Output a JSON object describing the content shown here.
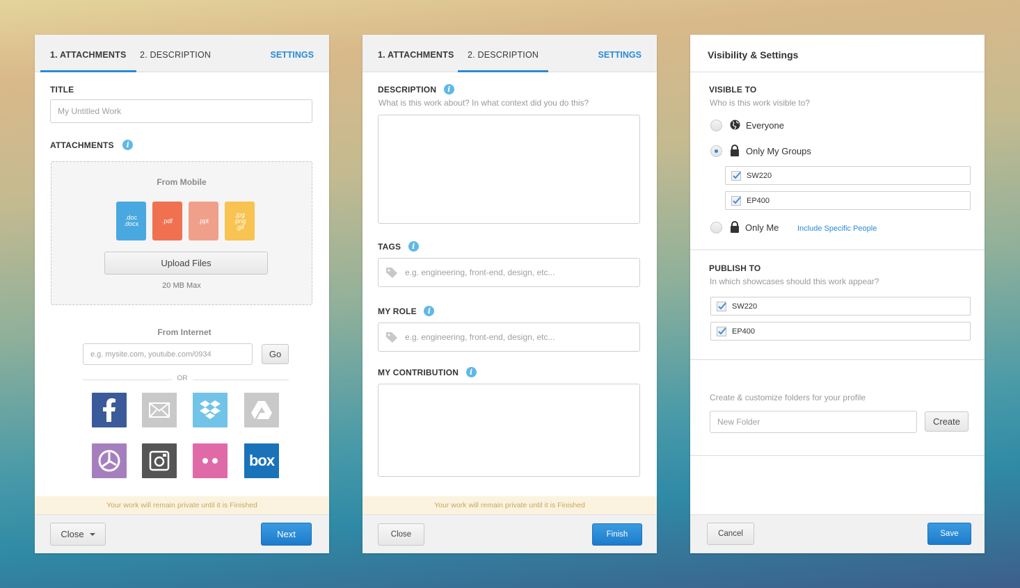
{
  "panel1": {
    "tabs": [
      "1. ATTACHMENTS",
      "2. DESCRIPTION"
    ],
    "settings": "SETTINGS",
    "title_label": "TITLE",
    "title_placeholder": "My Untitled Work",
    "attachments_label": "ATTACHMENTS",
    "from_mobile": "From Mobile",
    "file_types": [
      {
        "label": "doc\ndocx",
        "color": "#4aa8e0"
      },
      {
        "label": ".pdf",
        "color": "#f07150"
      },
      {
        "label": ".ppt",
        "color": "#f0a08a"
      },
      {
        "label": ".jpg\n.png\n.gif",
        "color": "#f8c350"
      }
    ],
    "upload_button": "Upload Files",
    "max_size": "20 MB Max",
    "from_internet": "From Internet",
    "url_placeholder": "e.g. mysite.com, youtube.com/0934",
    "go_button": "Go",
    "or_text": "OR",
    "services": [
      "facebook",
      "email",
      "dropbox",
      "google-drive",
      "picasa",
      "instagram",
      "flickr",
      "box"
    ],
    "box_label": "box",
    "notice": "Your work will remain private until it is Finished",
    "close_button": "Close",
    "next_button": "Next"
  },
  "panel2": {
    "tabs": [
      "1. ATTACHMENTS",
      "2. DESCRIPTION"
    ],
    "settings": "SETTINGS",
    "description_label": "DESCRIPTION",
    "description_hint": "What is this work about? In what context did you do this?",
    "tags_label": "TAGS",
    "tags_placeholder": "e.g. engineering, front-end, design, etc...",
    "role_label": "MY ROLE",
    "role_placeholder": "e.g. engineering, front-end, design, etc...",
    "contribution_label": "MY CONTRIBUTION",
    "notice": "Your work will remain private until it is Finished",
    "close_button": "Close",
    "finish_button": "Finish"
  },
  "panel3": {
    "title": "Visibility & Settings",
    "visible_label": "VISIBLE TO",
    "visible_hint": "Who is this work visible to?",
    "option_everyone": "Everyone",
    "option_groups": "Only My Groups",
    "groups": [
      "SW220",
      "EP400"
    ],
    "option_me": "Only Me",
    "include_people": "Include Specific People",
    "publish_label": "PUBLISH TO",
    "publish_hint": "In which showcases should this work appear?",
    "showcases": [
      "SW220",
      "EP400"
    ],
    "folder_hint": "Create & customize folders for your profile",
    "folder_placeholder": "New Folder",
    "create_button": "Create",
    "cancel_button": "Cancel",
    "save_button": "Save"
  }
}
